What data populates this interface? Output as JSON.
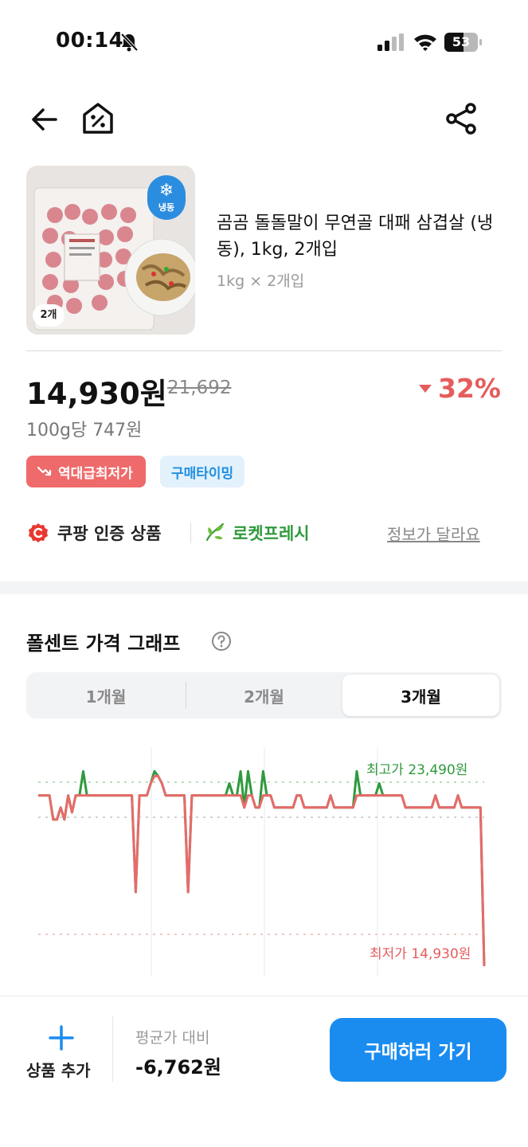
{
  "status_bar": {
    "time": "00:14",
    "battery": "53",
    "icons": [
      "bell-slash-icon",
      "signal-icon",
      "wifi-icon",
      "battery-icon"
    ]
  },
  "nav": {
    "icons": [
      "back-arrow-icon",
      "deal-home-icon",
      "share-icon"
    ]
  },
  "product": {
    "name": "곰곰 돌돌말이 무연골 대패 삼겹살 (냉동), 1kg, 2개입",
    "option": "1kg × 2개입",
    "thumb_badge_frozen": "냉동",
    "thumb_badge_count": "2개",
    "price_current": "14,930원",
    "price_original": "21,692",
    "discount": "32%",
    "unit_price": "100g당 747원",
    "badges": {
      "lowest": "역대급최저가",
      "timing": "구매타이밍"
    },
    "cert_label": "쿠팡 인증 상품",
    "fresh_label": "로켓프레시",
    "info_link": "정보가 달라요"
  },
  "graph": {
    "title": "폴센트 가격 그래프",
    "tabs": [
      "1개월",
      "2개월",
      "3개월"
    ],
    "selected_tab": "3개월",
    "max_label": "최고가 23,490원",
    "min_label": "최저가 14,930원",
    "colors": {
      "green": "#2f9a3d",
      "red": "#e86a6a"
    }
  },
  "chart_data": {
    "type": "line",
    "title": "",
    "xlabel": "",
    "ylabel": "",
    "ylim": [
      14500,
      24000
    ],
    "series": [
      {
        "values": [
          22000,
          22000,
          22000,
          22000,
          21000,
          21000,
          21500,
          21000,
          22000,
          21300,
          22000,
          22000,
          23000,
          22000,
          22000,
          22000,
          22000,
          22000,
          22000,
          22000,
          22000,
          22000,
          22000,
          22000,
          22000,
          22000,
          18000,
          22000,
          22000,
          22000,
          22500,
          23000,
          22800,
          22500,
          22000,
          22000,
          22000,
          22000,
          22000,
          22000,
          18000,
          22000,
          22000,
          22000,
          22000,
          22000,
          22000,
          22000,
          22000,
          22000,
          22000,
          22500,
          22000,
          22000,
          23000,
          21500,
          23000,
          22000,
          21500,
          21500,
          23000,
          22000,
          22000,
          21500,
          21500,
          21500,
          21500,
          21500,
          21500,
          22000,
          22000,
          21500,
          21500,
          21500,
          21500,
          21500,
          21500,
          21500,
          22000,
          21500,
          21500,
          21500,
          21500,
          21500,
          21500,
          23000,
          22000,
          22000,
          22000,
          22000,
          22000,
          22500,
          22000,
          22000,
          22000,
          22000,
          22000,
          22000,
          21500,
          21500,
          21500,
          21500,
          21500,
          21500,
          21500,
          21500,
          22000,
          21500,
          21500,
          21500,
          21500,
          21500,
          22000,
          21500,
          21500,
          21500,
          21500,
          21500,
          21500,
          14930
        ]
      }
    ]
  },
  "bottom": {
    "add_label": "상품 추가",
    "avg_label": "평균가 대비",
    "avg_value": "-6,762원",
    "buy_label": "구매하러 가기"
  }
}
